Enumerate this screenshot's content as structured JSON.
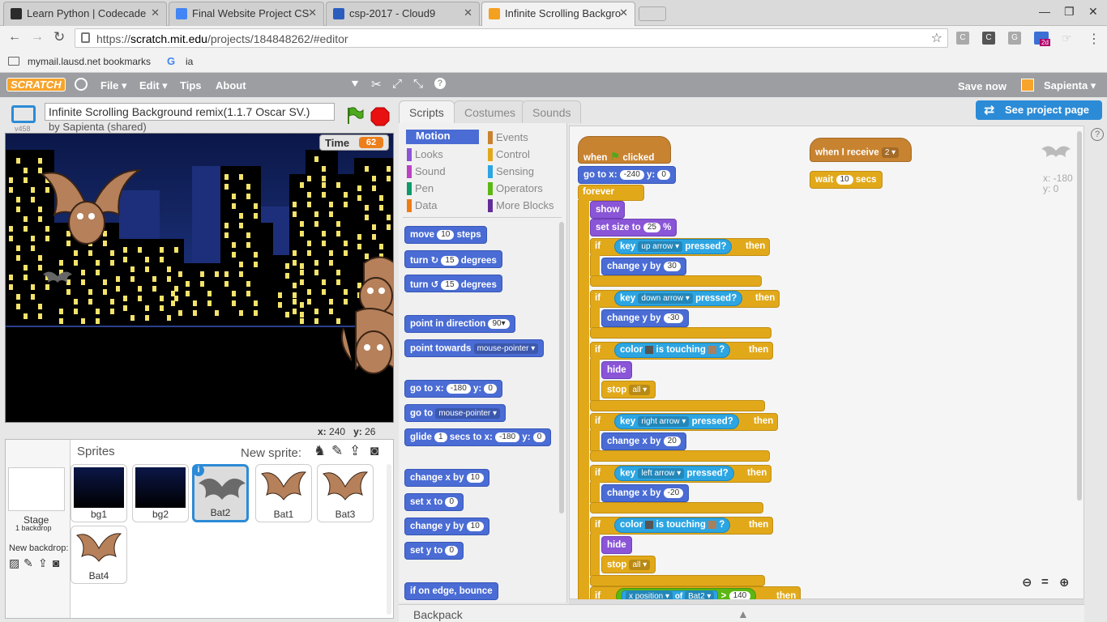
{
  "browser": {
    "tabs": [
      {
        "title": "Learn Python | Codecade",
        "favicon_color": "#2b2b2b"
      },
      {
        "title": "Final Website Project CS",
        "favicon_color": "#4285f4"
      },
      {
        "title": "csp-2017 - Cloud9",
        "favicon_color": "#2b5dbe"
      },
      {
        "title": "Infinite Scrolling Backgro",
        "favicon_color": "#f4a020"
      }
    ],
    "url_prefix": "https://",
    "url_domain": "scratch.mit.edu",
    "url_path": "/projects/184848262/#editor",
    "bookmarks": [
      "mymail.lausd.net bookmarks",
      "ia"
    ],
    "ext_badge": "2d"
  },
  "scratch": {
    "logo": "SCRATCH",
    "menu": [
      "File ▾",
      "Edit ▾",
      "Tips",
      "About"
    ],
    "save_now": "Save now",
    "user": "Sapienta ▾",
    "see_project": "See project page",
    "project_title": "Infinite Scrolling Background remix(1.1.7 Oscar SV.)",
    "by_line": "by Sapienta (shared)",
    "version": "v458",
    "timer_label": "Time",
    "timer_value": "62",
    "mouse_x_label": "x:",
    "mouse_x": "240",
    "mouse_y_label": "y:",
    "mouse_y": "26",
    "sprites_title": "Sprites",
    "new_sprite": "New sprite:",
    "stage_label": "Stage",
    "stage_sub": "1 backdrop",
    "new_backdrop": "New backdrop:",
    "sprites": [
      "bg1",
      "bg2",
      "Bat2",
      "Bat1",
      "Bat3",
      "Bat4"
    ],
    "selected_sprite": "Bat2",
    "editor_tabs": [
      "Scripts",
      "Costumes",
      "Sounds"
    ],
    "categories_left": [
      "Motion",
      "Looks",
      "Sound",
      "Pen",
      "Data"
    ],
    "categories_right": [
      "Events",
      "Control",
      "Sensing",
      "Operators",
      "More Blocks"
    ],
    "palette": {
      "move": "move",
      "move_n": "10",
      "steps": "steps",
      "turn": "turn",
      "turn_cw_n": "15",
      "turn_ccw_n": "15",
      "degrees": "degrees",
      "point_dir": "point in direction",
      "point_dir_n": "90▾",
      "point_towards": "point towards",
      "mouse_pointer": "mouse-pointer ▾",
      "goto_xy": "go to x:",
      "goto_x": "-180",
      "y_lbl": "y:",
      "goto_y": "0",
      "goto": "go to",
      "glide": "glide",
      "glide_n": "1",
      "glide_secs": "secs to x:",
      "glide_x": "-180",
      "glide_y": "0",
      "change_x": "change x by",
      "change_x_n": "10",
      "set_x": "set x to",
      "set_x_n": "0",
      "change_y": "change y by",
      "change_y_n": "10",
      "set_y": "set y to",
      "set_y_n": "0",
      "bounce": "if on edge, bounce"
    },
    "script": {
      "when": "when",
      "clicked": "clicked",
      "goto": "go to x:",
      "goto_x": "-240",
      "goto_y": "0",
      "forever": "forever",
      "show": "show",
      "set_size": "set size to",
      "set_size_n": "25",
      "pct": "%",
      "if": "if",
      "then": "then",
      "key": "key",
      "pressed": "pressed?",
      "up_arrow": "up arrow ▾",
      "down_arrow": "down arrow ▾",
      "right_arrow": "right arrow ▾",
      "left_arrow": "left arrow ▾",
      "change_y": "change y by",
      "cy1": "30",
      "cy2": "-30",
      "change_x": "change x by",
      "cx1": "20",
      "cx2": "-20",
      "color": "color",
      "is_touching": "is touching",
      "q": "?",
      "hide": "hide",
      "stop": "stop",
      "all": "all ▾",
      "x_position": "x position ▾",
      "of": "of",
      "bat2": "Bat2 ▾",
      "gt": ">",
      "gt_n": "140",
      "when_receive": "when I receive",
      "recv_n": "2 ▾",
      "wait": "wait",
      "wait_n": "10",
      "secs": "secs",
      "sprite_x": "x: -180",
      "sprite_y": "y: 0"
    },
    "backpack": "Backpack"
  },
  "colors": {
    "motion": "#4a6cd4",
    "events": "#c88330",
    "control": "#e1a91a",
    "looks": "#8a55d7",
    "sensing": "#2ca5e2",
    "operators": "#5cb712",
    "sound": "#bb42c3",
    "pen": "#0e9a6c",
    "data": "#ee7d16",
    "more": "#632d99"
  }
}
